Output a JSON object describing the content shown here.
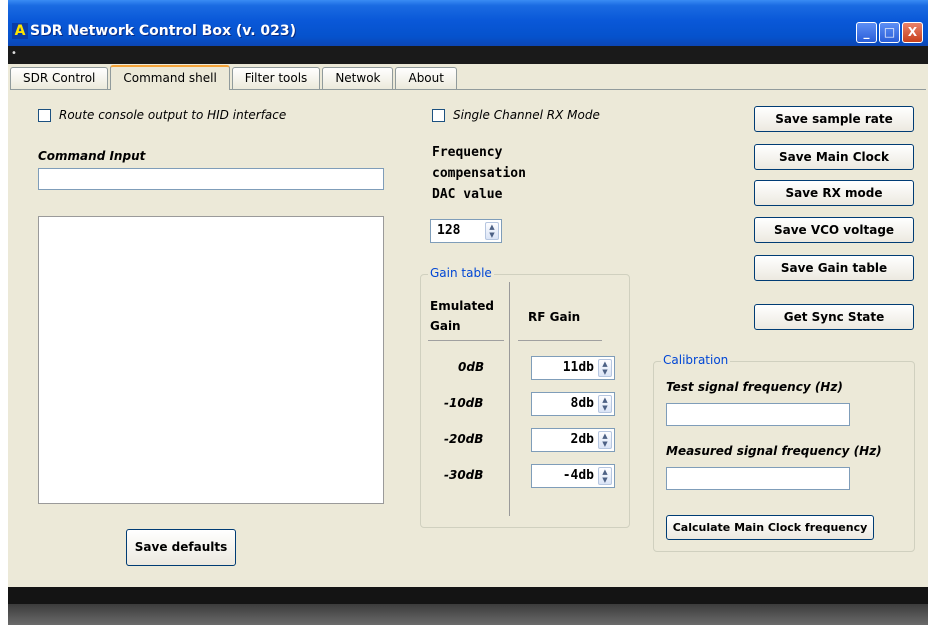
{
  "window": {
    "title": "SDR Network Control Box (v. 023)"
  },
  "titlebar_buttons": {
    "minimize": "_",
    "maximize": "□",
    "close": "X"
  },
  "tabs": [
    "SDR Control",
    "Command shell",
    "Filter tools",
    "Netwok",
    "About"
  ],
  "active_tab": "Command shell",
  "console": {
    "route_checkbox_label": "Route console output to HID interface",
    "route_checked": false,
    "command_input_label": "Command Input",
    "command_input_value": "",
    "output_text": "",
    "save_defaults_label": "Save defaults"
  },
  "rx": {
    "single_channel_label": "Single Channel RX Mode",
    "single_channel_checked": false,
    "freq_comp_label_lines": [
      "Frequency",
      "compensation",
      "DAC value"
    ],
    "dac_value": "128"
  },
  "gain_table": {
    "title": "Gain table",
    "col_emulated": [
      "Emulated",
      "Gain"
    ],
    "col_rf": "RF Gain",
    "rows": [
      {
        "emulated": "0dB",
        "rf": "11db"
      },
      {
        "emulated": "-10dB",
        "rf": "8db"
      },
      {
        "emulated": "-20dB",
        "rf": "2db"
      },
      {
        "emulated": "-30dB",
        "rf": "-4db"
      }
    ]
  },
  "save_buttons": {
    "sample_rate": "Save sample rate",
    "main_clock": "Save Main Clock",
    "rx_mode": "Save RX mode",
    "vco_voltage": "Save VCO voltage",
    "gain_table": "Save Gain table",
    "sync_state": "Get Sync State"
  },
  "calibration": {
    "title": "Calibration",
    "test_label": "Test signal frequency (Hz)",
    "test_value": "",
    "measured_label": "Measured signal frequency (Hz)",
    "measured_value": "",
    "calc_button": "Calculate Main Clock frequency"
  },
  "colors": {
    "title_blue": "#0552cc",
    "panel_bg": "#ece9d8",
    "group_title": "#0046d5",
    "tab_highlight": "#f5a43a"
  }
}
